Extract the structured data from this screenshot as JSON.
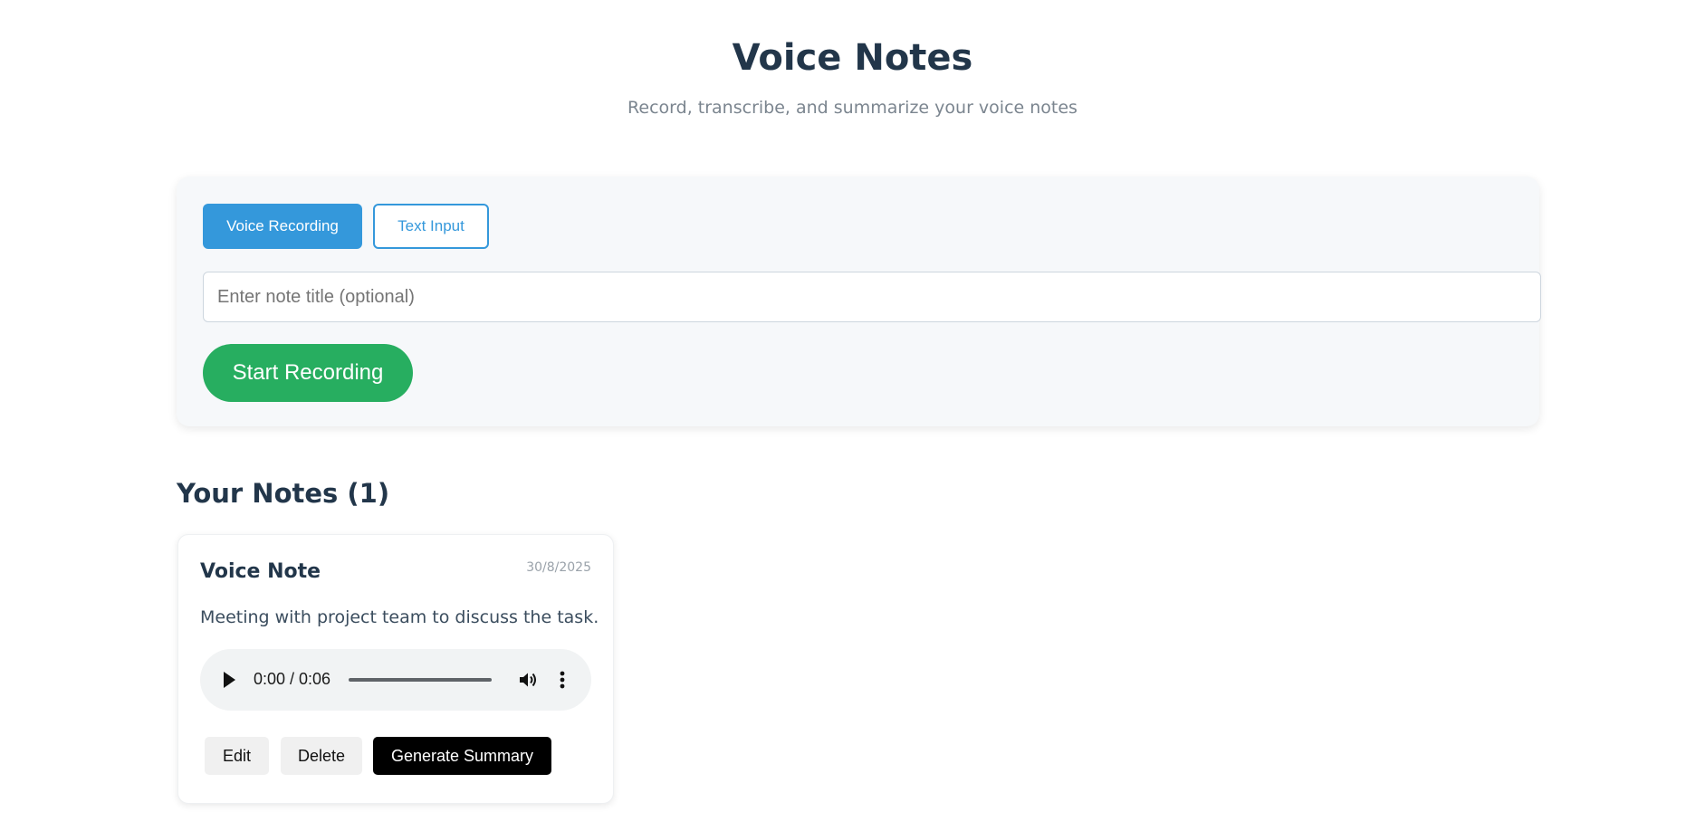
{
  "header": {
    "title": "Voice Notes",
    "subtitle": "Record, transcribe, and summarize your voice notes"
  },
  "composer": {
    "modes": {
      "voice_label": "Voice Recording",
      "text_label": "Text Input",
      "active": "voice"
    },
    "title_input": {
      "placeholder": "Enter note title (optional)",
      "value": ""
    },
    "record_label": "Start Recording"
  },
  "notes_section": {
    "heading": "Your Notes (1)",
    "notes": [
      {
        "title": "Voice Note",
        "date": "30/8/2025",
        "text": "Meeting with project team to discuss the task.",
        "audio": {
          "time": "0:00 / 0:06",
          "progress": 0
        },
        "actions": {
          "edit_label": "Edit",
          "delete_label": "Delete",
          "summary_label": "Generate Summary"
        }
      }
    ]
  },
  "icons": {
    "play": "play-icon",
    "volume": "volume-icon",
    "more": "more-vertical-icon"
  },
  "colors": {
    "primary_blue": "#3498db",
    "record_green": "#27ae60",
    "heading_dark": "#22364a",
    "summary_black": "#000000"
  }
}
